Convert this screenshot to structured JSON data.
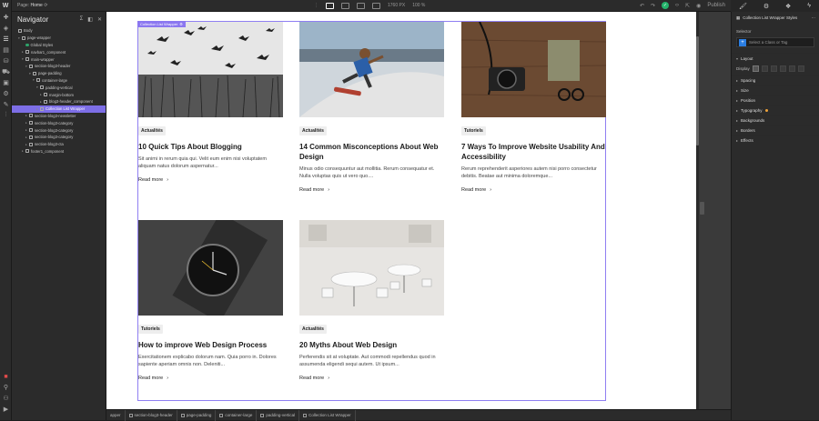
{
  "topbar": {
    "logo": "W",
    "page_label": "Page:",
    "page_name": "Home",
    "width_px": "1760 PX",
    "zoom": "100 %",
    "publish": "Publish"
  },
  "navigator": {
    "title": "Navigator",
    "tree": [
      {
        "label": "Body",
        "indent": 0,
        "type": "box"
      },
      {
        "label": "page-wrapper",
        "indent": 1,
        "type": "box",
        "caret": "▾"
      },
      {
        "label": "Global Styles",
        "indent": 2,
        "type": "dot"
      },
      {
        "label": "navbar1_component",
        "indent": 2,
        "type": "box",
        "caret": "▸"
      },
      {
        "label": "main-wrapper",
        "indent": 2,
        "type": "box",
        "caret": "▾"
      },
      {
        "label": "section-blog3-header",
        "indent": 3,
        "type": "box",
        "caret": "▾"
      },
      {
        "label": "page-padding",
        "indent": 4,
        "type": "box",
        "caret": "▾"
      },
      {
        "label": "container-large",
        "indent": 5,
        "type": "box",
        "caret": "▾"
      },
      {
        "label": "padding-vertical",
        "indent": 6,
        "type": "box",
        "caret": "▾"
      },
      {
        "label": "margin-bottom",
        "indent": 7,
        "type": "box",
        "caret": "▸"
      },
      {
        "label": "blog3-header_component",
        "indent": 7,
        "type": "box",
        "caret": "▸"
      },
      {
        "label": "Collection List Wrapper",
        "indent": 6,
        "type": "box",
        "caret": "▸",
        "selected": true
      },
      {
        "label": "section-blog3-newsletter",
        "indent": 3,
        "type": "box",
        "caret": "▸"
      },
      {
        "label": "section-blog3-category",
        "indent": 3,
        "type": "box",
        "caret": "▸"
      },
      {
        "label": "section-blog3-category",
        "indent": 3,
        "type": "box",
        "caret": "▸"
      },
      {
        "label": "section-blog3-category",
        "indent": 3,
        "type": "box",
        "caret": "▸"
      },
      {
        "label": "section-blog3-cta",
        "indent": 3,
        "type": "box",
        "caret": "▸"
      },
      {
        "label": "footer1_component",
        "indent": 2,
        "type": "box",
        "caret": "▸"
      }
    ]
  },
  "canvas": {
    "wrapper_label": "Collection List Wrapper",
    "cards": [
      {
        "tag": "Actualités",
        "title": "10 Quick Tips About Blogging",
        "desc": "Sit animi in rerum quia qui. Velit eum enim nisi voluptatem aliquam natus dolorum aspernatur...",
        "read": "Read more"
      },
      {
        "tag": "Actualités",
        "title": "14 Common Misconceptions About Web Design",
        "desc": "Minus odio consequuntur aut mollitia. Rerum consequatur et. Nulla voluptas quis ut vero quo....",
        "read": "Read more"
      },
      {
        "tag": "Tutoriels",
        "title": "7 Ways To Improve Website Usability And Accessibility",
        "desc": "Rerum reprehenderit asperiores autem nisi porro consectetur debitis. Beatae aut minima doloremque...",
        "read": "Read more"
      },
      {
        "tag": "Tutoriels",
        "title": "How to improve Web Design Process",
        "desc": "Exercitationem explicabo dolorum nam. Quia porro in. Dolores sapiente aperiam omnis non. Deleniti...",
        "read": "Read more"
      },
      {
        "tag": "Actualités",
        "title": "20 Myths About Web Design",
        "desc": "Perferendis sit at voluptate. Aut commodi repellendus quod in assumenda eligendi sequi autem. Ut ipsum...",
        "read": "Read more"
      }
    ]
  },
  "breadcrumbs": [
    "apper",
    "section-blog3-header",
    "page-padding",
    "container-large",
    "padding-vertical",
    "Collection List Wrapper"
  ],
  "right_panel": {
    "header": "Collection List Wrapper Styles",
    "selector_label": "Selector",
    "class_placeholder": "Select a Class or Tag",
    "layout_label": "Layout",
    "display_label": "Display",
    "props": [
      "Spacing",
      "Size",
      "Position",
      "Typography",
      "Backgrounds",
      "Borders",
      "Effects"
    ]
  },
  "colors": {
    "accent": "#8b77f0",
    "publish_green": "#24b36b",
    "class_blue": "#2a7de1"
  }
}
